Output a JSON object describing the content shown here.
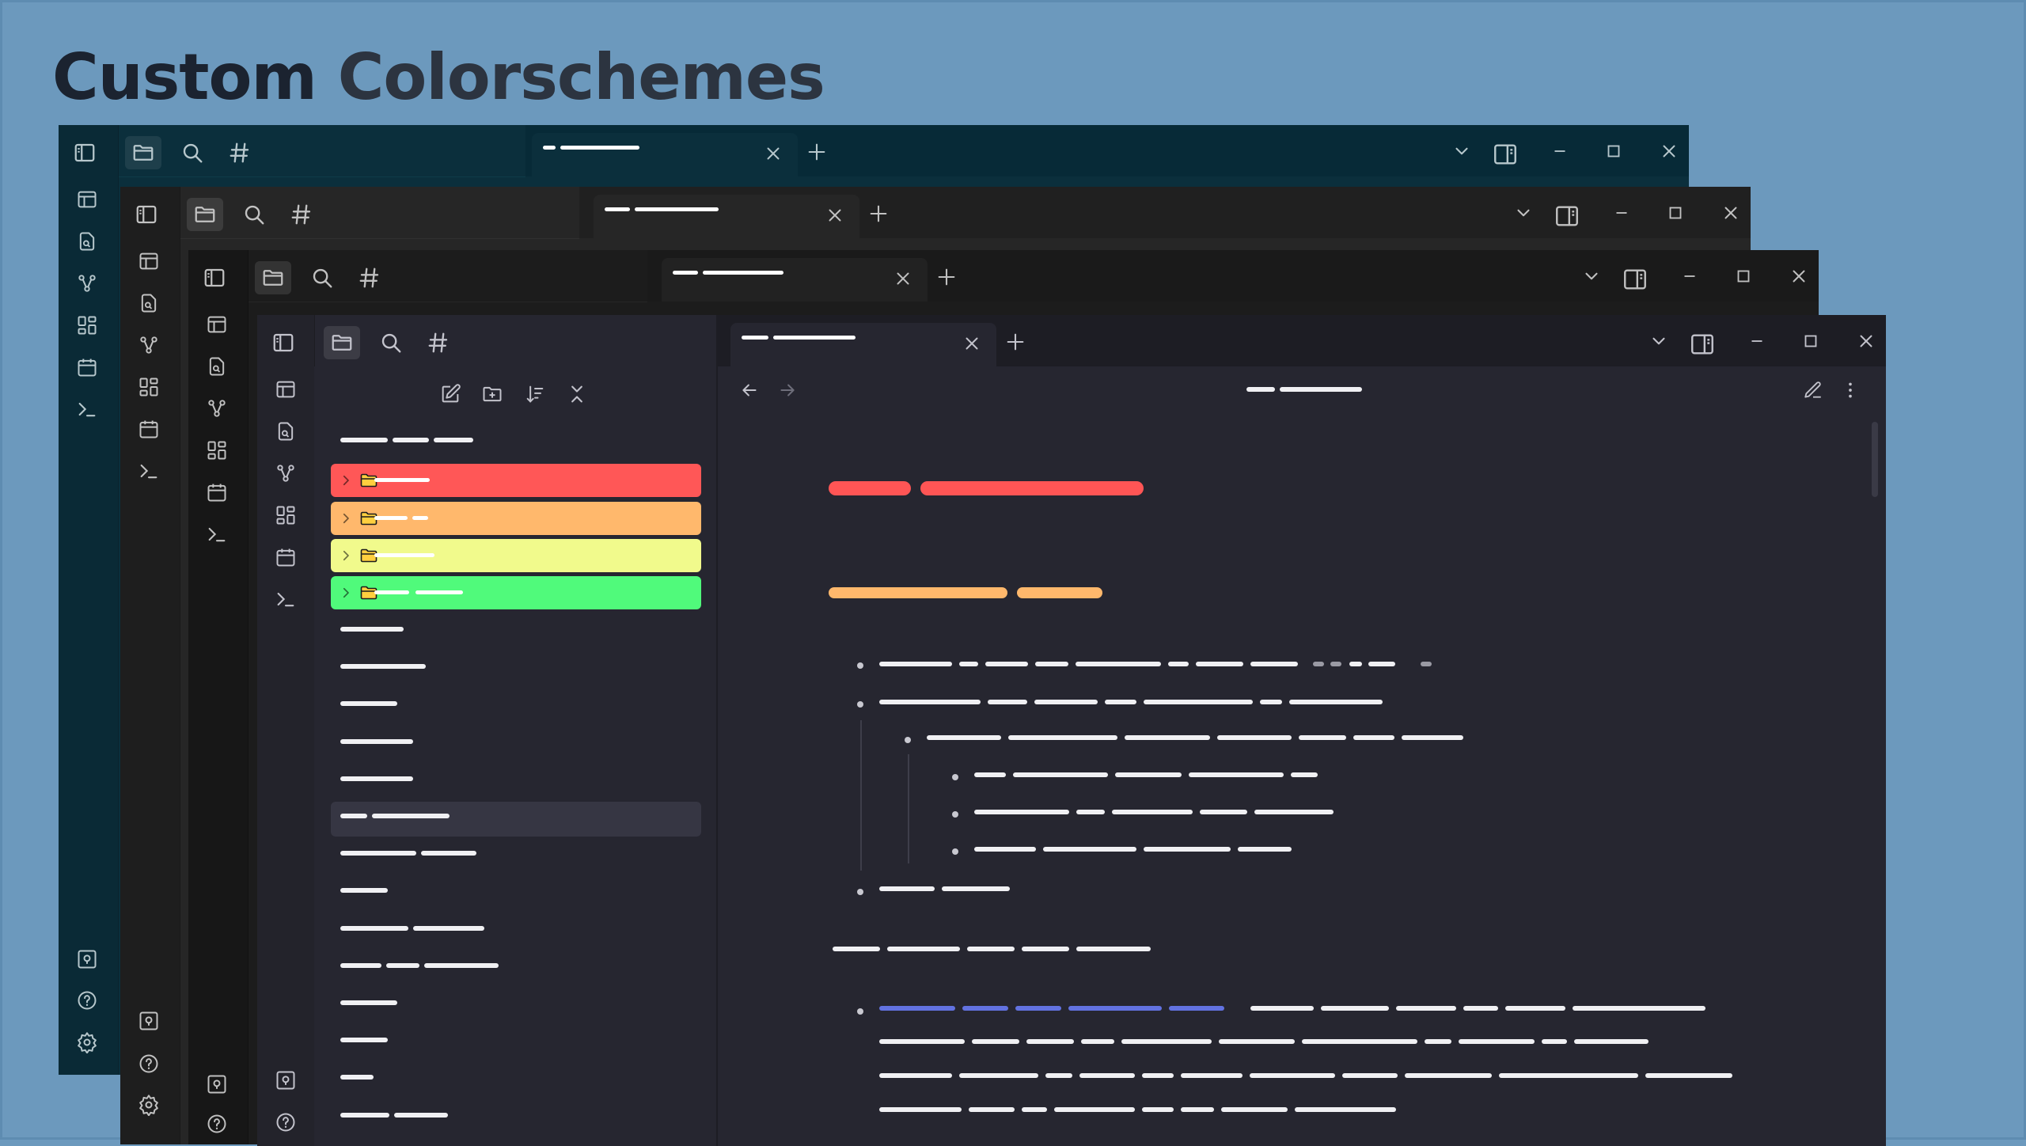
{
  "heading": {
    "word1": "Custom",
    "word2": "Colorschemes"
  },
  "windows": [
    {
      "theme": "teal",
      "background": "#0b2f3c"
    },
    {
      "theme": "dark-grey",
      "background": "#262626"
    },
    {
      "theme": "black",
      "background": "#1c1c1c"
    },
    {
      "theme": "slate",
      "background": "#262630"
    }
  ],
  "folder_colors": {
    "red": "#ff5757",
    "orange": "#ffb86c",
    "yellow": "#f1fa8c",
    "green": "#50fa7b"
  },
  "heading_colors": {
    "h1": "#ff5555",
    "h2": "#ffb86c",
    "link": "#6272e0"
  },
  "icons": {
    "ribbon_top": [
      "sidebar-toggle-icon",
      "folder-icon",
      "search-icon",
      "hashtag-icon"
    ],
    "ribbon_left": [
      "layout-icon",
      "file-search-icon",
      "graph-icon",
      "grid-icon",
      "calendar-icon",
      "terminal-icon"
    ],
    "ribbon_bottom": [
      "vault-icon",
      "help-icon",
      "settings-icon"
    ],
    "window_controls": [
      "chevron-down-icon",
      "split-pane-icon",
      "minimize-icon",
      "maximize-icon",
      "close-icon"
    ],
    "file_toolbar": [
      "new-note-icon",
      "new-folder-icon",
      "sort-icon",
      "collapse-icon"
    ],
    "editor_nav": [
      "back-arrow-icon",
      "forward-arrow-icon",
      "edit-icon",
      "more-options-icon"
    ]
  }
}
